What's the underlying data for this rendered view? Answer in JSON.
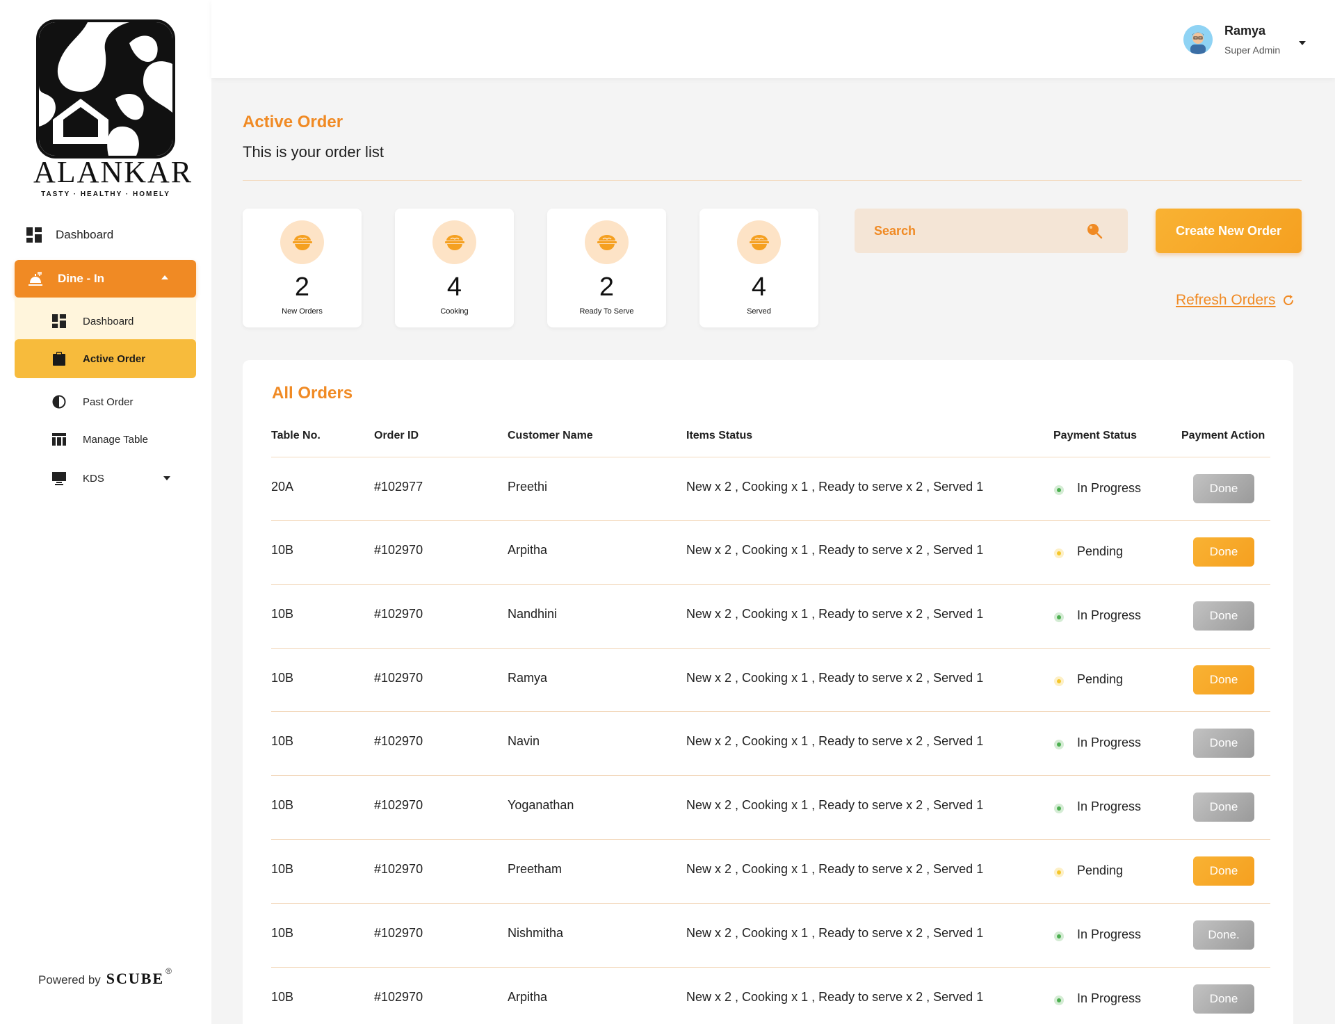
{
  "brand": {
    "name": "ALANKAR",
    "tagline": "TASTY  ·  HEALTHY  ·  HOMELY"
  },
  "sidebar": {
    "dashboard": "Dashboard",
    "dine_in": "Dine - In",
    "sub": {
      "dashboard": "Dashboard",
      "active_order": "Active Order",
      "past_order": "Past Order",
      "manage_table": "Manage Table",
      "kds": "KDS"
    },
    "powered_by": "Powered by",
    "powered_brand": "SCUBE",
    "powered_reg": "®"
  },
  "header": {
    "user_name": "Ramya",
    "user_role": "Super Admin"
  },
  "page": {
    "title": "Active Order",
    "subtitle": "This is your order list"
  },
  "stats": [
    {
      "value": "2",
      "label": "New Orders"
    },
    {
      "value": "4",
      "label": "Cooking"
    },
    {
      "value": "2",
      "label": "Ready To Serve"
    },
    {
      "value": "4",
      "label": "Served"
    }
  ],
  "search": {
    "placeholder": "Search"
  },
  "actions": {
    "create": "Create New Order",
    "refresh": "Refresh Orders"
  },
  "orders": {
    "title": "All Orders",
    "columns": [
      "Table No.",
      "Order ID",
      "Customer Name",
      "Items Status",
      "Payment Status",
      "Payment Action"
    ],
    "rows": [
      {
        "table": "20A",
        "id": "#102977",
        "customer": "Preethi",
        "items": "New x 2 , Cooking x 1 , Ready to serve x 2 , Served 1",
        "status": "In Progress",
        "action": "Done"
      },
      {
        "table": "10B",
        "id": "#102970",
        "customer": "Arpitha",
        "items": "New x 2 , Cooking x 1 , Ready to serve x 2 , Served 1",
        "status": "Pending",
        "action": "Done"
      },
      {
        "table": "10B",
        "id": "#102970",
        "customer": "Nandhini",
        "items": "New x 2 , Cooking x 1 , Ready to serve x 2 , Served 1",
        "status": "In Progress",
        "action": "Done"
      },
      {
        "table": "10B",
        "id": "#102970",
        "customer": "Ramya",
        "items": "New x 2 , Cooking x 1 , Ready to serve x 2 , Served 1",
        "status": "Pending",
        "action": "Done"
      },
      {
        "table": "10B",
        "id": "#102970",
        "customer": "Navin",
        "items": "New x 2 , Cooking x 1 , Ready to serve x 2 , Served 1",
        "status": "In Progress",
        "action": "Done"
      },
      {
        "table": "10B",
        "id": "#102970",
        "customer": "Yoganathan",
        "items": "New x 2 , Cooking x 1 , Ready to serve x 2 , Served 1",
        "status": "In Progress",
        "action": "Done"
      },
      {
        "table": "10B",
        "id": "#102970",
        "customer": "Preetham",
        "items": "New x 2 , Cooking x 1 , Ready to serve x 2 , Served 1",
        "status": "Pending",
        "action": "Done"
      },
      {
        "table": "10B",
        "id": "#102970",
        "customer": "Nishmitha",
        "items": "New x 2 , Cooking x 1 , Ready to serve x 2 , Served 1",
        "status": "In Progress",
        "action": "Done."
      },
      {
        "table": "10B",
        "id": "#102970",
        "customer": "Arpitha",
        "items": "New x 2 , Cooking x 1 , Ready to serve x 2 , Served 1",
        "status": "In Progress",
        "action": "Done"
      }
    ]
  },
  "colors": {
    "accent": "#f08a24",
    "gold": "#f7bb3c",
    "status_progress": "#4caf50",
    "status_pending": "#f5c62a"
  }
}
